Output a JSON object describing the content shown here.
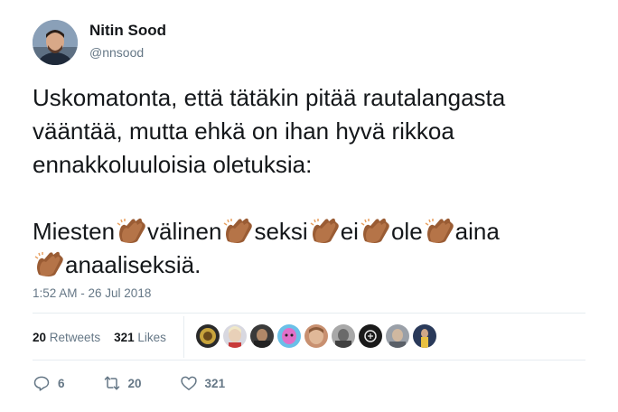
{
  "author": {
    "name": "Nitin Sood",
    "handle": "@nnsood",
    "avatar_icon": "profile-photo"
  },
  "tweet": {
    "paragraph1": "Uskomatonta, että tätäkin pitää rautalangasta vääntää, mutta ehkä on ihan hyvä rikkoa ennakkoluuloisia oletuksia:",
    "words": [
      "Miesten",
      "välinen",
      "seksi",
      "ei",
      "ole",
      "aina",
      "anaaliseksiä."
    ],
    "clap_icon": "clapping-hands-emoji",
    "clap_color": "#a0643c"
  },
  "timestamp": "1:52 AM - 26 Jul 2018",
  "stats": {
    "retweets_count": "20",
    "retweets_label": "Retweets",
    "likes_count": "321",
    "likes_label": "Likes"
  },
  "likers": [
    {
      "color": "#c8a43c"
    },
    {
      "color": "#e8d0b8"
    },
    {
      "color": "#4a4a4a"
    },
    {
      "color": "#e070c8"
    },
    {
      "color": "#e0b898"
    },
    {
      "color": "#6a6a6a"
    },
    {
      "color": "#1a1a1a"
    },
    {
      "color": "#9aa0a8"
    },
    {
      "color": "#3a5a9a"
    }
  ],
  "actions": {
    "reply_count": "6",
    "retweet_count": "20",
    "like_count": "321"
  }
}
